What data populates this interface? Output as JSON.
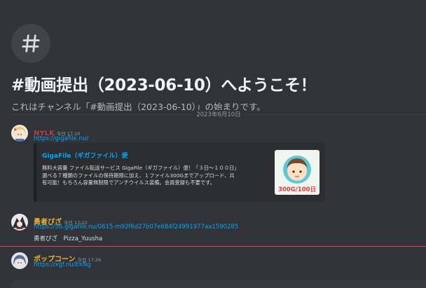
{
  "channel_header": {
    "icon": "hash-icon",
    "title": "#動画提出（2023-06-10）へようこそ！",
    "subtitle": "これはチャンネル「#動画提出（2023-06-10）」の始まりです。"
  },
  "date_divider": "2023年6月10日",
  "messages": [
    {
      "author": "NYLK",
      "author_color": "#c43b3b",
      "timestamp": "今日 17:20",
      "link": "https://gigafile.nu/",
      "embed": {
        "title": "GigaFile（ギガファイル）便",
        "description": [
          "無料大容量 ファイル転送サービス GigaFile（ギガファイル）便！「３日〜１００日」",
          "選べる７種類のファイルの保持期限に加え、１ファイル300Gまでアップロード、共",
          "有可能！もちろん容量無制限でアンチウイルス装備。会員登録も不要です。"
        ],
        "thumbnail_text": "300G/100日"
      }
    },
    {
      "author": "勇者ぴざ",
      "author_color": "#f0b232",
      "timestamp": "今日 17:22",
      "link": "https://56.gigafile.nu/0615-m92f6d27b07e684f24991977aa1590285",
      "text": "勇者ぴざ　Pizza_Yuusha"
    },
    {
      "author": "ポップコーン",
      "author_color": "#f0b232",
      "timestamp": "今日 17:26",
      "link": "https://xgf.nu/EkNg"
    }
  ],
  "colors": {
    "background": "#313338",
    "link": "#00a8fc",
    "embed_background": "#2b2d31",
    "mention_line": "#e0444b"
  }
}
